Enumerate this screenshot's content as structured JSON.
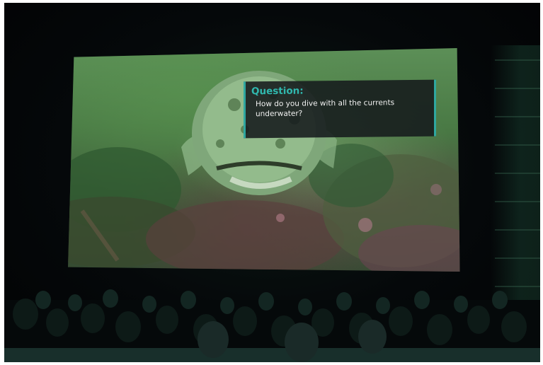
{
  "scene": {
    "caption": {
      "title": "Question:",
      "text": "How do you dive with all the currents underwater?"
    },
    "colors": {
      "accent": "#2fa7a0",
      "caption_title": "#30b8ae",
      "screen_tint": "#4a7a45"
    }
  }
}
